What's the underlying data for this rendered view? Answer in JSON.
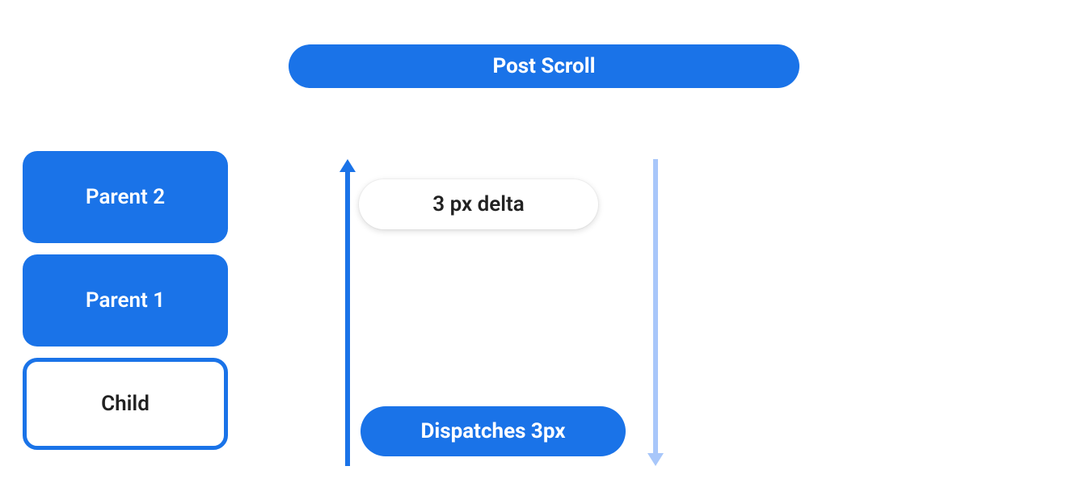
{
  "title": "Post Scroll",
  "hierarchy": {
    "parent2": "Parent 2",
    "parent1": "Parent 1",
    "child": "Child"
  },
  "delta_label": "3 px delta",
  "dispatch_label": "Dispatches 3px",
  "colors": {
    "primary": "#1a73e8",
    "arrow_light": "#a8c7fa"
  }
}
